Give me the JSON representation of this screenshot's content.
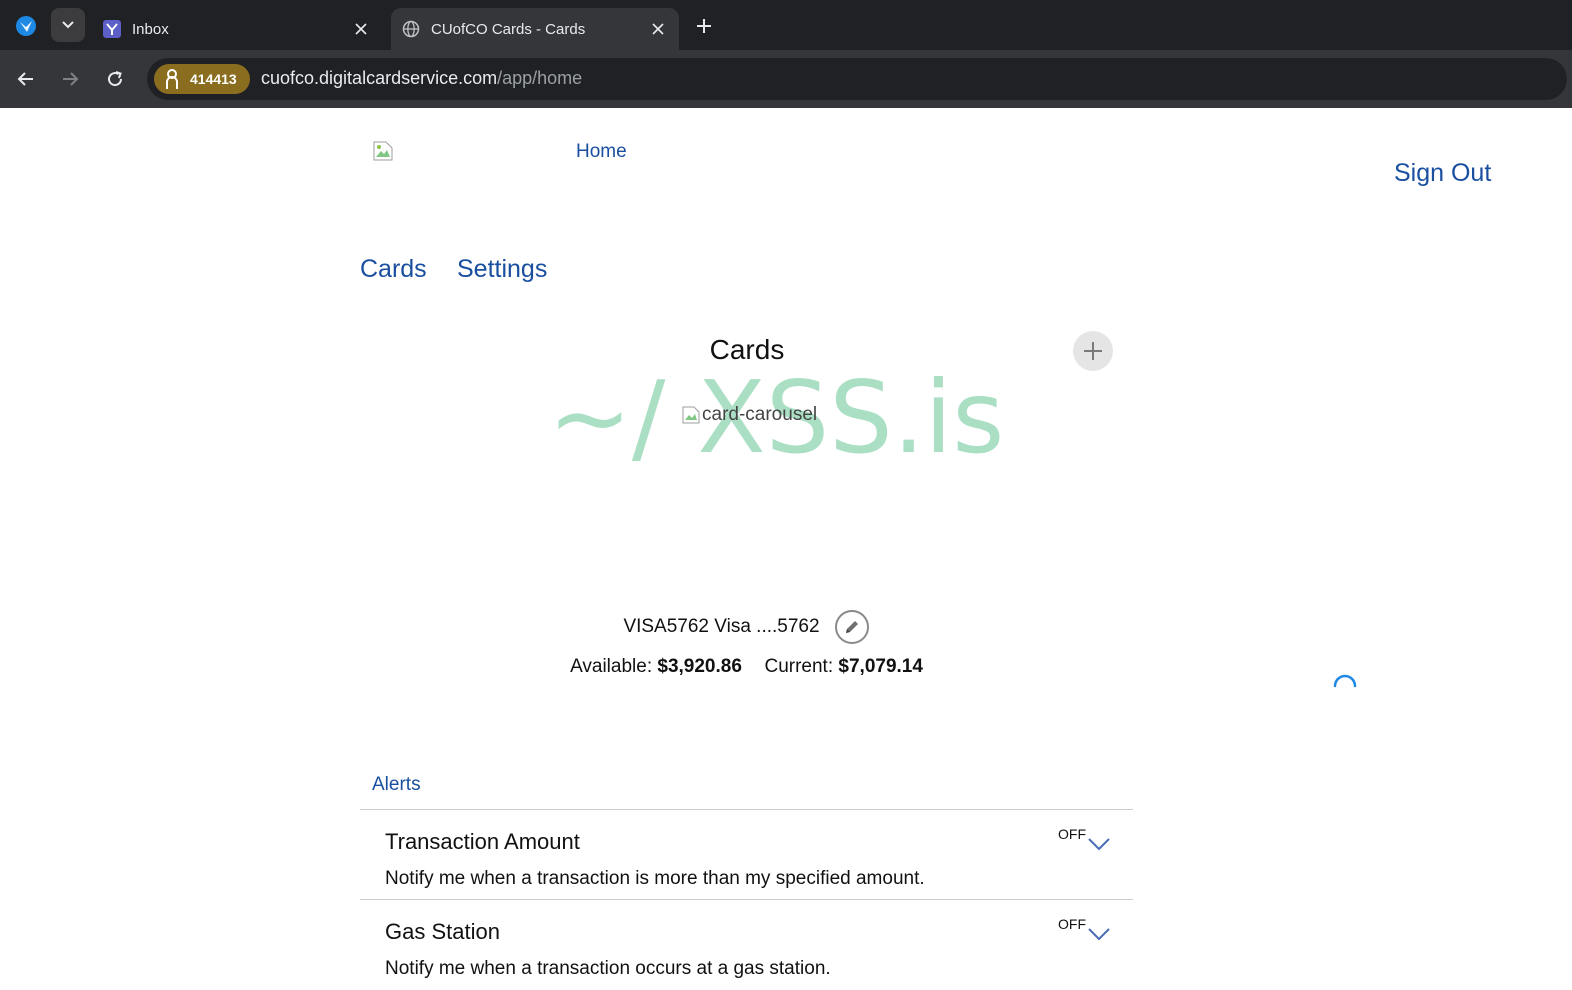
{
  "browser": {
    "tabs": [
      {
        "title": "Inbox",
        "favicon": "yahoo-mail-icon",
        "active": false
      },
      {
        "title": "CUofCO Cards - Cards",
        "favicon": "globe-icon",
        "active": true
      }
    ],
    "address": {
      "badge_text": "414413",
      "host": "cuofco.digitalcardservice.com",
      "path": "/app/home"
    }
  },
  "header": {
    "home_label": "Home",
    "signout_label": "Sign Out"
  },
  "nav": {
    "cards_label": "Cards",
    "settings_label": "Settings"
  },
  "cards": {
    "title": "Cards",
    "carousel_alt": "card-carousel",
    "watermark": "~/ XSS.is",
    "card_name": "VISA5762 Visa ....5762",
    "available_label": "Available:",
    "available_value": "$3,920.86",
    "current_label": "Current:",
    "current_value": "$7,079.14"
  },
  "alerts": {
    "heading": "Alerts",
    "items": [
      {
        "title": "Transaction Amount",
        "description": "Notify me when a transaction is more than my specified amount.",
        "status": "OFF"
      },
      {
        "title": "Gas Station",
        "description": "Notify me when a transaction occurs at a gas station.",
        "status": "OFF"
      }
    ]
  },
  "colors": {
    "link": "#1a4fa0",
    "chrome_dark": "#202124",
    "chrome_toolbar": "#35363a",
    "badge": "#8b6d1f",
    "spinner": "#1e88e5"
  }
}
